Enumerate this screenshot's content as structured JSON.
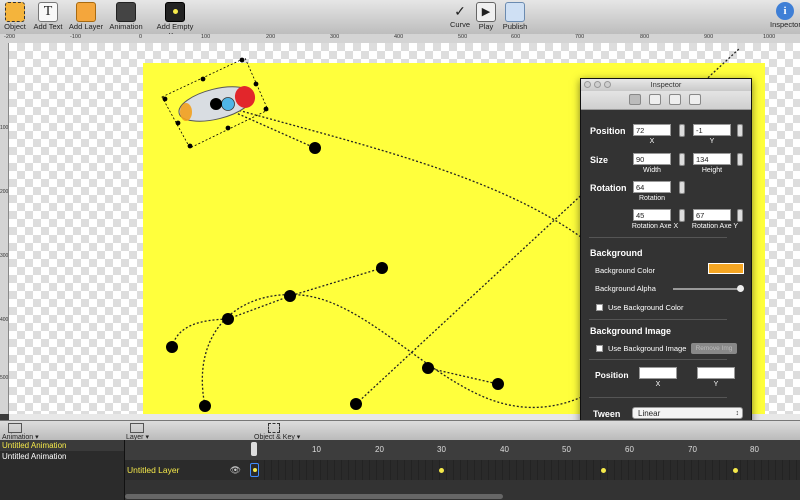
{
  "toolbar": {
    "object": "Object",
    "add_text": "Add Text",
    "add_layer": "Add Layer",
    "animation": "Animation",
    "add_empty_key": "Add Empty Key",
    "curve": "Curve",
    "play": "Play",
    "publish": "Publish",
    "inspector": "Inspector"
  },
  "ruler": {
    "h_ticks": [
      "-200",
      "-100",
      "0",
      "100",
      "200",
      "300",
      "400",
      "500",
      "600",
      "700",
      "800",
      "900",
      "1000"
    ],
    "v_ticks": [
      "100",
      "200",
      "300",
      "400",
      "500"
    ]
  },
  "inspector": {
    "title": "Inspector",
    "position_label": "Position",
    "position_x": "72",
    "position_y": "-1",
    "x_label": "X",
    "y_label": "Y",
    "size_label": "Size",
    "width": "90",
    "height": "134",
    "width_label": "Width",
    "height_label": "Height",
    "rotation_label": "Rotation",
    "rotation": "64",
    "rotation_sub": "Rotation",
    "axe_x": "45",
    "axe_y": "67",
    "axe_x_label": "Rotation Axe X",
    "axe_y_label": "Rotation Axe Y",
    "background_heading": "Background",
    "background_color_label": "Background Color",
    "background_color": "#f5a623",
    "background_alpha_label": "Background Alpha",
    "background_alpha": 1.0,
    "use_background_color": "Use Background Color",
    "background_image_heading": "Background Image",
    "use_background_image": "Use Background Image",
    "remove_img": "Remove Img",
    "bg_position_label": "Position",
    "bg_x_label": "X",
    "bg_y_label": "Y",
    "tween_label": "Tween",
    "tween_value": "Linear"
  },
  "bottom": {
    "animation_label": "Animation",
    "layer_label": "Layer",
    "object_key_label": "Object & Key"
  },
  "animations": [
    {
      "name": "Untitled Animation",
      "selected": true
    },
    {
      "name": "Untitled Animation",
      "selected": false
    }
  ],
  "timeline": {
    "frames": [
      "10",
      "20",
      "30",
      "40",
      "50",
      "60",
      "70",
      "80"
    ],
    "layer_name": "Untitled Layer"
  },
  "colors": {
    "stage": "#ffff3c",
    "accent_yellow": "#f5e94a"
  }
}
